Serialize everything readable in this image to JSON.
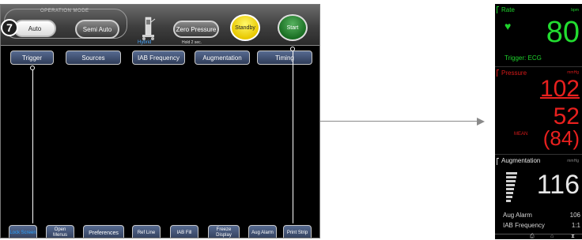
{
  "console": {
    "operation_mode_caption": "OPERATION MODE",
    "step_badge": "7",
    "mode_buttons": {
      "auto": "Auto",
      "semi_auto": "Semi Auto",
      "zero_pressure": "Zero Pressure",
      "zero_hold_note": "Hold 2 sec.",
      "standby": "Standby",
      "start": "Start"
    },
    "hybrid_label": "Hybrid",
    "menu_tabs": [
      "Trigger",
      "Sources",
      "IAB Frequency",
      "Augmentation",
      "Timing"
    ],
    "bottom_buttons": [
      "Lock Screen",
      "Open Menus",
      "Preferences",
      "Ref Line",
      "IAB Fill",
      "Freeze Display",
      "Aug Alarm",
      "Print Strip"
    ],
    "colors": {
      "standby": "#e8c800",
      "start": "#196e22",
      "menu_button": "#3d4c6e",
      "hybrid_text": "#4aa8ff",
      "lock_text": "#2aa3ff"
    }
  },
  "monitor": {
    "rate": {
      "title": "Rate",
      "unit": "bpm",
      "icon": "heart-icon",
      "value": "80",
      "trigger": "Trigger: ECG",
      "color": "#22dd30"
    },
    "pressure": {
      "title": "Pressure",
      "unit": "mmHg",
      "systolic": "102",
      "diastolic": "52",
      "mean_label": "MEAN",
      "mean": "(84)",
      "color": "#e8201e"
    },
    "augmentation": {
      "title": "Augmentation",
      "unit": "mmHg",
      "value": "116",
      "rows": [
        {
          "label": "Aug Alarm",
          "value": "106"
        },
        {
          "label": "IAB Frequency",
          "value": "1:1"
        }
      ]
    }
  }
}
